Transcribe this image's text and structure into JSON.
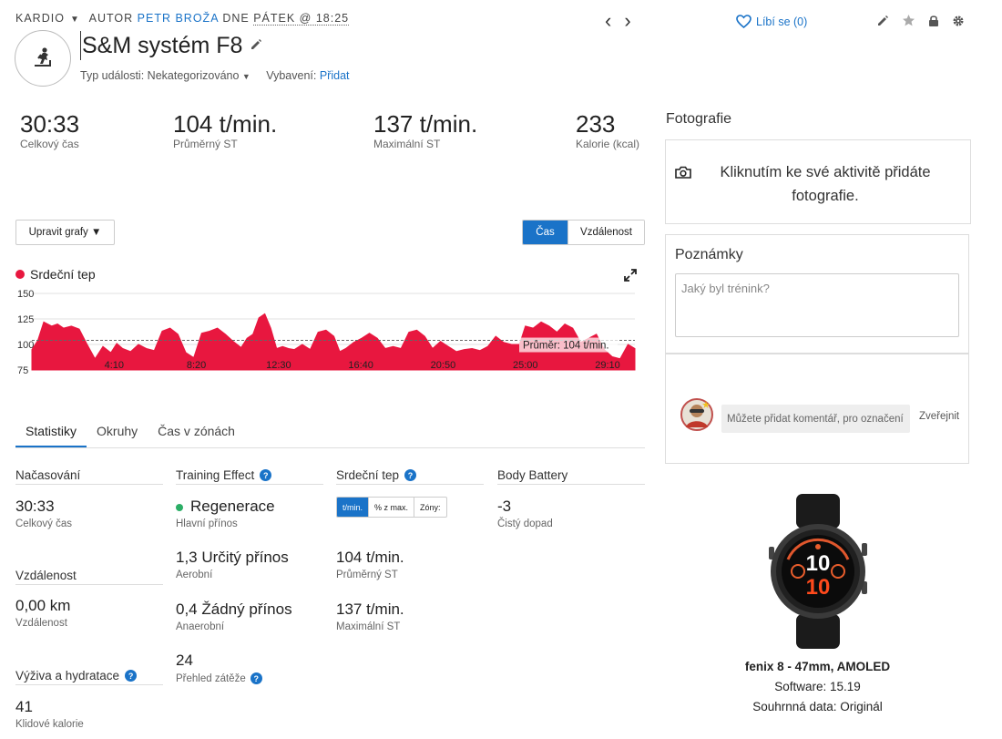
{
  "header": {
    "category": "KARDIO",
    "author_prefix": "AUTOR",
    "author": "PETR BROŽA",
    "date_prefix": "DNE",
    "datetime": "PÁTEK @ 18:25",
    "title": "S&M systém F8",
    "event_type_label": "Typ události:",
    "event_type_value": "Nekategorizováno",
    "equipment_label": "Vybavení:",
    "equipment_action": "Přidat",
    "like_label": "Líbí se (0)"
  },
  "summary": [
    {
      "value": "30:33",
      "label": "Celkový čas"
    },
    {
      "value": "104 t/min.",
      "label": "Průměrný ST"
    },
    {
      "value": "137 t/min.",
      "label": "Maximální ST"
    },
    {
      "value": "233",
      "label": "Kalorie (kcal)"
    }
  ],
  "chart_controls": {
    "edit_graphs": "Upravit grafy ▼",
    "time": "Čas",
    "distance": "Vzdálenost"
  },
  "chart_data": {
    "type": "area",
    "series": [
      {
        "name": "Srdeční tep",
        "color": "#e8173f"
      }
    ],
    "ytick_labels": [
      "150",
      "125",
      "100",
      "75"
    ],
    "ylim": [
      75,
      150
    ],
    "xtick_labels": [
      "4:10",
      "8:20",
      "12:30",
      "16:40",
      "20:50",
      "25:00",
      "29:10"
    ],
    "xlim_min": [
      0,
      30.55
    ],
    "average": 104,
    "average_label": "Průměr: 104 t/min.",
    "x": [
      0,
      0.3,
      0.6,
      1,
      1.3,
      1.6,
      2,
      2.4,
      2.8,
      3.2,
      3.6,
      4.0,
      4.3,
      4.6,
      5.0,
      5.4,
      5.8,
      6.2,
      6.6,
      7.0,
      7.4,
      7.8,
      8.2,
      8.6,
      9.0,
      9.4,
      9.8,
      10.2,
      10.6,
      10.9,
      11.2,
      11.5,
      11.8,
      12.1,
      12.4,
      12.7,
      13.0,
      13.3,
      13.7,
      14.1,
      14.5,
      14.9,
      15.3,
      15.6,
      15.9,
      16.3,
      16.7,
      17.1,
      17.5,
      17.9,
      18.3,
      18.7,
      19.1,
      19.5,
      19.9,
      20.3,
      20.7,
      21.1,
      21.5,
      21.9,
      22.3,
      22.7,
      23.1,
      23.5,
      23.9,
      24.3,
      24.7,
      25.0,
      25.4,
      25.8,
      26.2,
      26.6,
      27.0,
      27.4,
      27.8,
      28.2,
      28.6,
      29.0,
      29.4,
      29.8,
      30.2,
      30.55
    ],
    "y": [
      95,
      104,
      122,
      118,
      120,
      116,
      118,
      115,
      100,
      86,
      98,
      92,
      101,
      96,
      93,
      100,
      96,
      94,
      113,
      116,
      110,
      92,
      87,
      111,
      113,
      116,
      110,
      103,
      97,
      106,
      110,
      126,
      130,
      116,
      96,
      98,
      96,
      95,
      100,
      95,
      112,
      114,
      108,
      93,
      96,
      102,
      106,
      111,
      106,
      96,
      98,
      96,
      112,
      114,
      108,
      96,
      103,
      98,
      93,
      95,
      96,
      94,
      98,
      108,
      102,
      100,
      100,
      118,
      116,
      122,
      118,
      112,
      120,
      116,
      102,
      106,
      110,
      95,
      88,
      86,
      100,
      96
    ],
    "title": "",
    "xlabel": "",
    "ylabel": ""
  },
  "tabs": [
    "Statistiky",
    "Okruhy",
    "Čas v zónách"
  ],
  "stats": {
    "timing": {
      "title": "Načasování",
      "value": "30:33",
      "label": "Celkový čas"
    },
    "distance": {
      "title": "Vzdálenost",
      "value": "0,00 km",
      "label": "Vzdálenost"
    },
    "nutrition": {
      "title": "Výživa a hydratace",
      "value": "41",
      "label": "Klidové kalorie"
    },
    "training_effect": {
      "title": "Training Effect",
      "primary_value": "Regenerace",
      "primary_label": "Hlavní přínos",
      "aerobic_value": "1,3 Určitý přínos",
      "aerobic_label": "Aerobní",
      "anaerobic_value": "0,4 Žádný přínos",
      "anaerobic_label": "Anaerobní",
      "load_value": "24",
      "load_label": "Přehled zátěže"
    },
    "heart_rate": {
      "title": "Srdeční tep",
      "unit_options": [
        "t/min.",
        "% z max.",
        "Zóny:"
      ],
      "avg_value": "104 t/min.",
      "avg_label": "Průměrný ST",
      "max_value": "137 t/min.",
      "max_label": "Maximální ST"
    },
    "body_battery": {
      "title": "Body Battery",
      "value": "-3",
      "label": "Čistý dopad"
    }
  },
  "photos": {
    "title": "Fotografie",
    "prompt_line1": "Kliknutím ke své aktivitě přidáte",
    "prompt_line2": "fotografie."
  },
  "notes": {
    "title": "Poznámky",
    "placeholder": "Jaký byl trénink?"
  },
  "comments": {
    "placeholder": "Můžete přidat komentář, pro označení",
    "publish": "Zveřejnit"
  },
  "device": {
    "name": "fenix 8 - 47mm, AMOLED",
    "software": "Software: 15.19",
    "data": "Souhrnná data: Originál",
    "face_top": "10",
    "face_bottom": "10"
  },
  "colors": {
    "accent": "#1a73c8",
    "heart_rate": "#e8173f",
    "positive": "#2bae66"
  }
}
